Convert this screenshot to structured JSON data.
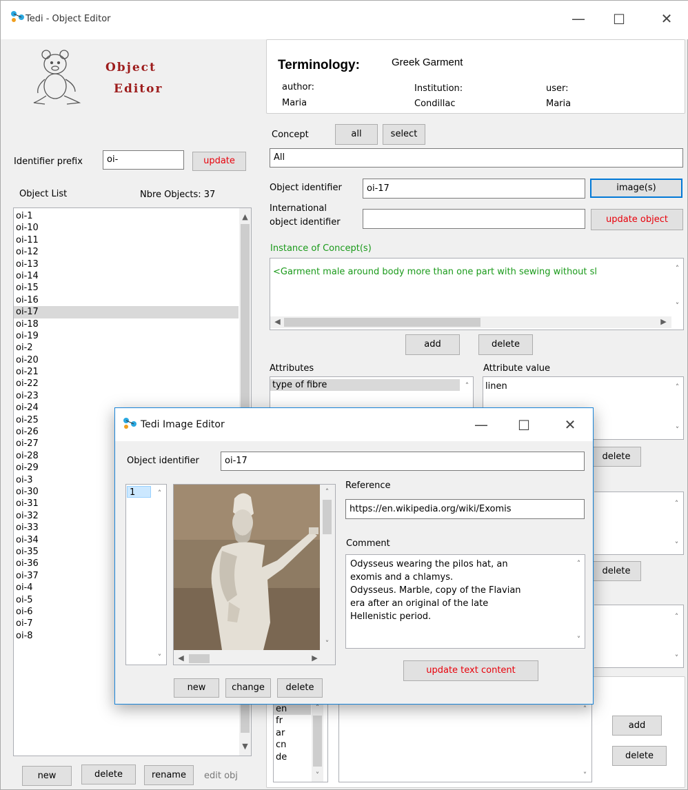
{
  "main_window": {
    "title": "Tedi - Object Editor",
    "controls": {
      "minimize": "—",
      "maximize": "☐",
      "close": "✕"
    },
    "logo": {
      "line1": "Object",
      "line2": "Editor"
    },
    "terminology": {
      "label": "Terminology:",
      "value": "Greek Garment",
      "author_label": "author:",
      "author": "Maria",
      "institution_label": "Institution:",
      "institution": "Condillac",
      "user_label": "user:",
      "user": "Maria"
    },
    "concept": {
      "label": "Concept",
      "all_button": "all",
      "select_button": "select",
      "value": "All"
    },
    "identifier_prefix": {
      "label": "Identifier prefix",
      "value": "oi-",
      "update_button": "update"
    },
    "object_list": {
      "label": "Object List",
      "count_label": "Nbre Objects: 37",
      "selected": "oi-17",
      "items": [
        "oi-1",
        "oi-10",
        "oi-11",
        "oi-12",
        "oi-13",
        "oi-14",
        "oi-15",
        "oi-16",
        "oi-17",
        "oi-18",
        "oi-19",
        "oi-2",
        "oi-20",
        "oi-21",
        "oi-22",
        "oi-23",
        "oi-24",
        "oi-25",
        "oi-26",
        "oi-27",
        "oi-28",
        "oi-29",
        "oi-3",
        "oi-30",
        "oi-31",
        "oi-32",
        "oi-33",
        "oi-34",
        "oi-35",
        "oi-36",
        "oi-37",
        "oi-4",
        "oi-5",
        "oi-6",
        "oi-7",
        "oi-8"
      ],
      "new_button": "new",
      "delete_button": "delete",
      "rename_button": "rename",
      "edit_label": "edit obj"
    },
    "object_identifier": {
      "label": "Object identifier",
      "value": "oi-17",
      "images_button": "image(s)"
    },
    "international_identifier": {
      "label_line1": "International",
      "label_line2": "object identifier",
      "value": "",
      "update_button": "update object"
    },
    "instance_of": {
      "label": "Instance of Concept(s)",
      "value": "<Garment male around body more than one part with sewing without sl",
      "add_button": "add",
      "delete_button": "delete"
    },
    "attributes": {
      "label": "Attributes",
      "items": [
        "type of fibre"
      ],
      "value_label": "Attribute value",
      "value": "linen",
      "delete_button": "delete"
    },
    "second_section": {
      "delete_button": "delete"
    },
    "languages": {
      "items": [
        "en",
        "fr",
        "ar",
        "cn",
        "de"
      ],
      "selected": "en",
      "add_button": "add",
      "delete_button": "delete"
    }
  },
  "image_dialog": {
    "title": "Tedi Image Editor",
    "controls": {
      "minimize": "—",
      "maximize": "☐",
      "close": "✕"
    },
    "object_identifier_label": "Object identifier",
    "object_identifier": "oi-17",
    "image_list": [
      "1"
    ],
    "image_alt": "Statue of Odysseus",
    "new_button": "new",
    "change_button": "change",
    "delete_button": "delete",
    "reference_label": "Reference",
    "reference": "https://en.wikipedia.org/wiki/Exomis",
    "comment_label": "Comment",
    "comment_lines": [
      "Odysseus wearing the pilos hat, an",
      "exomis and a chlamys.",
      "Odysseus. Marble, copy of the Flavian",
      "era after an original of the late",
      "Hellenistic period."
    ],
    "update_button": "update text content"
  },
  "colors": {
    "accent_red": "#e8000a",
    "green_text": "#1a9a1a",
    "logo_red": "#9d1c1c",
    "focus_blue": "#0078d7"
  }
}
